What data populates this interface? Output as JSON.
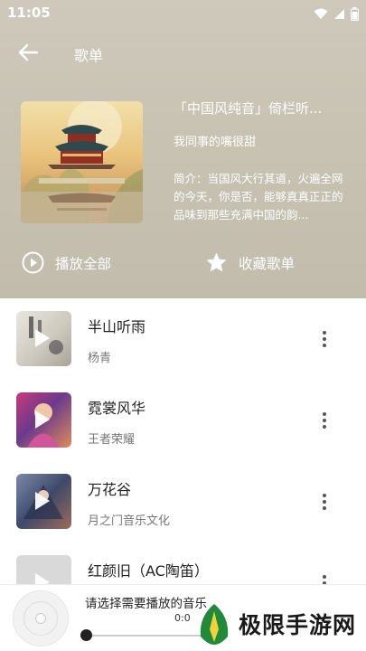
{
  "status": {
    "time": "11:05",
    "icons": [
      "wifi-icon",
      "signal-icon",
      "battery-icon"
    ]
  },
  "titlebar": {
    "title": "歌单"
  },
  "playlist": {
    "name": "「中国风纯音」倚栏听...",
    "author": "我同事的嘴很甜",
    "description": "简介：当国风大行其道，火遍全网的今天，你是否，能够真真正正的品味到那些充满中国的韵..."
  },
  "actions": {
    "play_all": "播放全部",
    "collect": "收藏歌单"
  },
  "songs": [
    {
      "name": "半山听雨",
      "artist": "杨青"
    },
    {
      "name": "霓裳风华",
      "artist": "王者荣耀"
    },
    {
      "name": "万花谷",
      "artist": "月之门音乐文化"
    },
    {
      "name": "红颜旧（AC陶笛）",
      "artist": ""
    }
  ],
  "player": {
    "prompt": "请选择需要播放的音乐",
    "time": "0:0",
    "progress": 0
  },
  "watermark": {
    "text": "极限手游网"
  },
  "colors": {
    "header_bg": "#c9c3b4",
    "text_primary": "#222222",
    "text_secondary": "#777777"
  }
}
